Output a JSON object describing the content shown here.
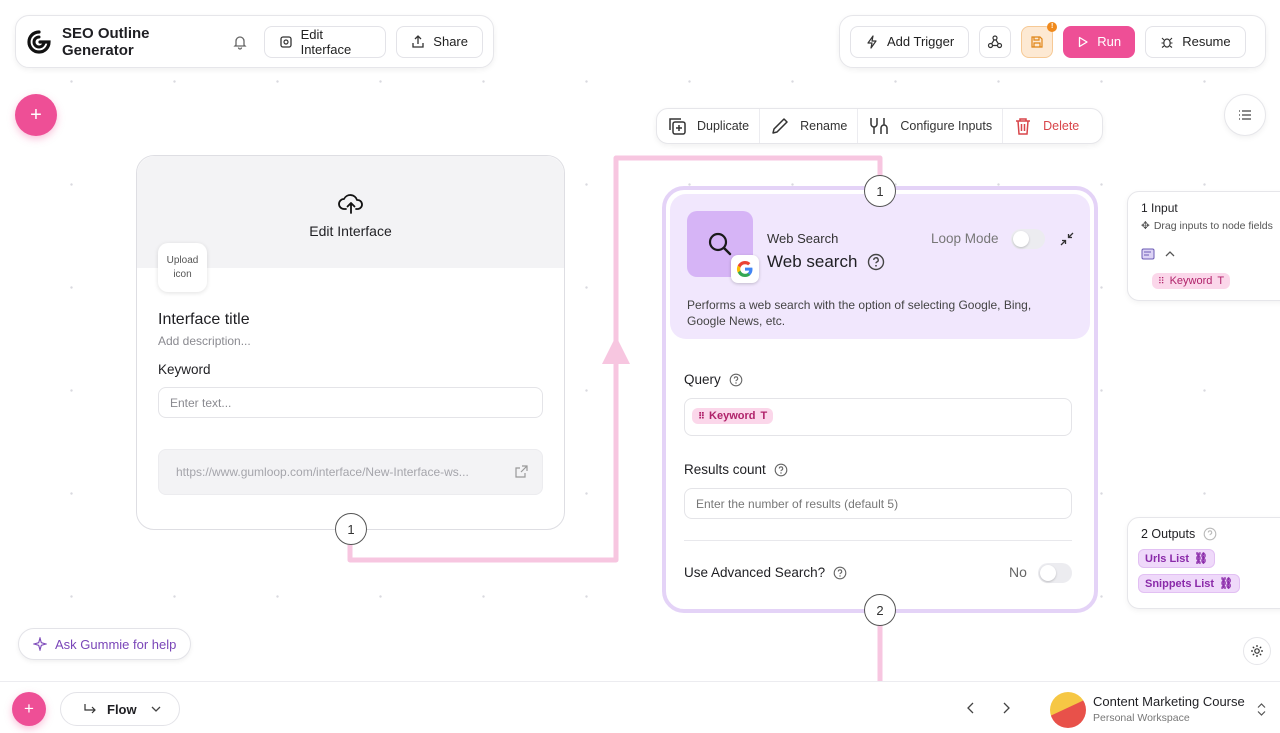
{
  "app": {
    "title": "SEO Outline Generator",
    "edit_interface_label": "Edit Interface",
    "share_label": "Share"
  },
  "toolbar_right": {
    "add_trigger_label": "Add Trigger",
    "save_badge": "!",
    "run_label": "Run",
    "resume_label": "Resume"
  },
  "add_button_symbol": "+",
  "node_toolbar": {
    "duplicate": "Duplicate",
    "rename": "Rename",
    "configure_inputs": "Configure Inputs",
    "delete": "Delete"
  },
  "interface_card": {
    "header_label": "Edit Interface",
    "upload_icon_label": "Upload icon",
    "title": "Interface title",
    "description": "Add description...",
    "field_label": "Keyword",
    "field_placeholder": "Enter text...",
    "url": "https://www.gumloop.com/interface/New-Interface-ws...",
    "output_number": "1"
  },
  "web_node": {
    "input_number": "1",
    "output_number": "2",
    "category": "Web Search",
    "title": "Web search",
    "loop_mode_label": "Loop Mode",
    "description": "Performs a web search with the option of selecting Google, Bing, Google News, etc.",
    "query_label": "Query",
    "query_tag": "Keyword",
    "results_count_label": "Results count",
    "results_count_placeholder": "Enter the number of results (default 5)",
    "advanced_search_label": "Use Advanced Search?",
    "advanced_search_value": "No"
  },
  "inputs_panel": {
    "title": "1 Input",
    "hint": "Drag inputs to node fields",
    "tag": "Keyword"
  },
  "outputs_panel": {
    "title": "2 Outputs",
    "outputs": [
      "Urls List",
      "Snippets List"
    ]
  },
  "ask_help_label": "Ask Gummie for help",
  "bottom": {
    "flow_label": "Flow",
    "workspace_name": "Content Marketing Course",
    "workspace_type": "Personal Workspace"
  },
  "colors": {
    "accent_pink": "#ee4f96",
    "node_border": "#e4d3f7",
    "edge_pink": "#f7c6e0"
  }
}
